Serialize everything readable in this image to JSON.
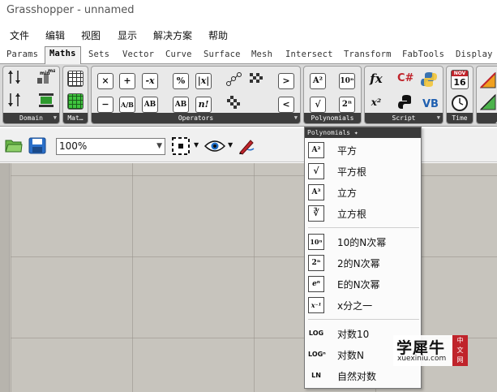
{
  "window": {
    "title": "Grasshopper - unnamed"
  },
  "menubar": {
    "items": [
      "文件",
      "编辑",
      "视图",
      "显示",
      "解决方案",
      "帮助"
    ]
  },
  "tabs": [
    "Params",
    "Maths",
    "Sets",
    "Vector",
    "Curve",
    "Surface",
    "Mesh",
    "Intersect",
    "Transform",
    "FabTools",
    "Display"
  ],
  "active_tab": "Maths",
  "ribbon": {
    "panels": [
      "Domain",
      "Mat…",
      "Operators",
      "Polynomials",
      "Script",
      "Time"
    ],
    "domain_icons": [
      "domain-bounds-icon",
      "remap-numbers-icon",
      "construct-domain-icon",
      "bounds-2d-icon"
    ],
    "matrix_icons": [
      "matrix-icon",
      "construct-matrix-icon"
    ],
    "operator_glyphs": [
      "×",
      "+",
      "-x",
      "%",
      "|x|",
      "−",
      "A/B",
      "AB",
      "AB",
      "n!"
    ],
    "compare_glyphs": [
      ">",
      "<"
    ],
    "polynomial_glyphs": [
      "A²",
      "10ⁿ",
      "√",
      "2ⁿ"
    ],
    "script_glyphs": [
      "fx",
      "C#",
      "x²"
    ],
    "time_glyphs": [
      "16",
      "NOV"
    ]
  },
  "toolbar": {
    "zoom_value": "100%"
  },
  "dropdown": {
    "header": "Polynomials",
    "items": [
      {
        "icon": "A²",
        "label": "平方"
      },
      {
        "icon": "√",
        "label": "平方根"
      },
      {
        "icon": "A³",
        "label": "立方"
      },
      {
        "icon": "∛",
        "label": "立方根"
      },
      {
        "icon": "10ⁿ",
        "label": "10的N次幂"
      },
      {
        "icon": "2ⁿ",
        "label": "2的N次幂"
      },
      {
        "icon": "eⁿ",
        "label": "E的N次幂"
      },
      {
        "icon": "x⁻¹",
        "label": "x分之一"
      },
      {
        "icon": "LOG",
        "label": "对数10"
      },
      {
        "icon": "LOGⁿ",
        "label": "对数N"
      },
      {
        "icon": "LN",
        "label": "自然对数"
      }
    ]
  },
  "watermark": {
    "brand": "学犀牛",
    "url": "xuexiniu.com",
    "seal": "中文网"
  },
  "colors": {
    "ribbon_label_bg": "#3d3d3d",
    "canvas_bg": "#c7c4bd",
    "accent_red": "#c0242b"
  }
}
